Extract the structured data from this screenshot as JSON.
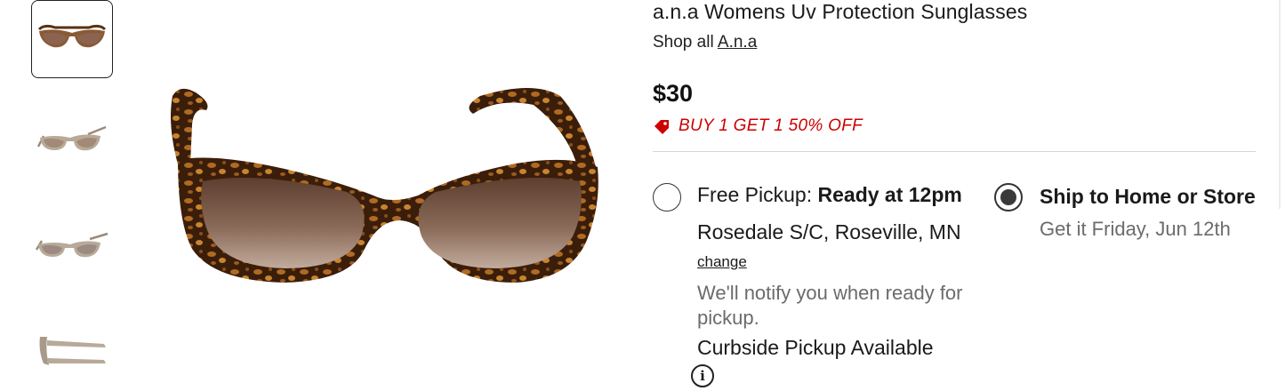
{
  "product": {
    "title": "a.n.a Womens Uv Protection Sunglasses",
    "shop_all_prefix": "Shop all",
    "brand": "A.n.a",
    "price": "$30",
    "promo": "BUY 1 GET 1 50% OFF"
  },
  "thumbnails": [
    {
      "view": "front",
      "selected": true
    },
    {
      "view": "angle",
      "selected": false
    },
    {
      "view": "angle-2",
      "selected": false
    },
    {
      "view": "side",
      "selected": false
    }
  ],
  "fulfillment": {
    "pickup": {
      "label_prefix": "Free Pickup:",
      "label_bold": "Ready at 12pm",
      "store": "Rosedale S/C, Roseville, MN",
      "change": "change",
      "notify": "We'll notify you when ready for pickup.",
      "curbside": "Curbside Pickup Available",
      "selected": false
    },
    "ship": {
      "title": "Ship to Home or Store",
      "subtitle": "Get it Friday, Jun 12th",
      "selected": true
    }
  },
  "colors": {
    "promo": "#cc0000",
    "frame_tortoise": "#5a3212",
    "lens_brown": "#6e4a36"
  }
}
